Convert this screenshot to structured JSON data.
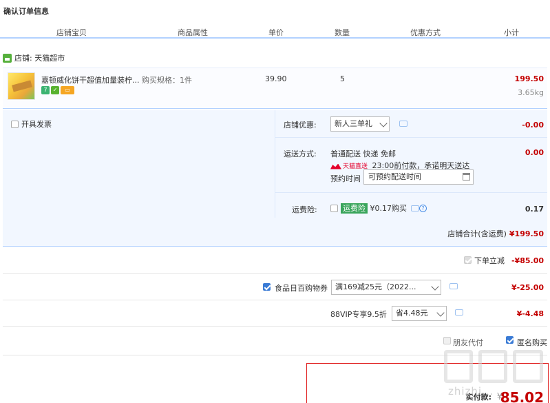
{
  "page_title": "确认订单信息",
  "columns": [
    "店铺宝贝",
    "商品属性",
    "单价",
    "数量",
    "优惠方式",
    "小计"
  ],
  "shop": {
    "label": "店铺: 天猫超市"
  },
  "item": {
    "title": "嘉顿威化饼干超值加量装柠...",
    "spec": "购买规格：1件",
    "badges": [
      "7",
      "✓",
      "▭"
    ],
    "price": "39.90",
    "quantity": "5",
    "subtotal": "199.50",
    "weight": "3.65kg"
  },
  "invoice": {
    "label": "开具发票",
    "checked": false
  },
  "shop_discount": {
    "label": "店铺优惠:",
    "selected": "新人三单礼",
    "amount": "-0.00"
  },
  "shipping": {
    "label": "运送方式:",
    "method": "普通配送 快递 免邮",
    "tmall_tag": "天猫直送",
    "promise": "23:00前付款，承诺明天送达",
    "amount": "0.00",
    "reserve_label": "预约时间",
    "reserve_placeholder": "可预约配送时间"
  },
  "insurance": {
    "label": "运费险:",
    "tag": "运费险",
    "price_text": "¥0.17购买",
    "amount": "0.17",
    "help": "?"
  },
  "shop_total": {
    "label": "店铺合计(含运费)",
    "value": "¥199.50"
  },
  "instant_discount": {
    "label": "下单立减",
    "value": "-¥85.00"
  },
  "coupon": {
    "label": "食品日百购物券",
    "selected": "满169减25元（2022...",
    "value": "¥-25.00",
    "checked": true
  },
  "vip": {
    "label": "88VIP专享9.5折",
    "selected": "省4.48元",
    "value": "¥-4.48"
  },
  "friend_pay": {
    "label": "朋友代付",
    "checked": false
  },
  "anonymous": {
    "label": "匿名购买",
    "checked": true
  },
  "payment": {
    "label": "实付款:",
    "symbol": "¥",
    "amount": "85.02"
  },
  "watermark": {
    "text": "zhizhi..."
  },
  "colors": {
    "price_red": "#c40000",
    "accent_blue": "#b2d1ff",
    "panel_bg": "#f2f7ff"
  }
}
